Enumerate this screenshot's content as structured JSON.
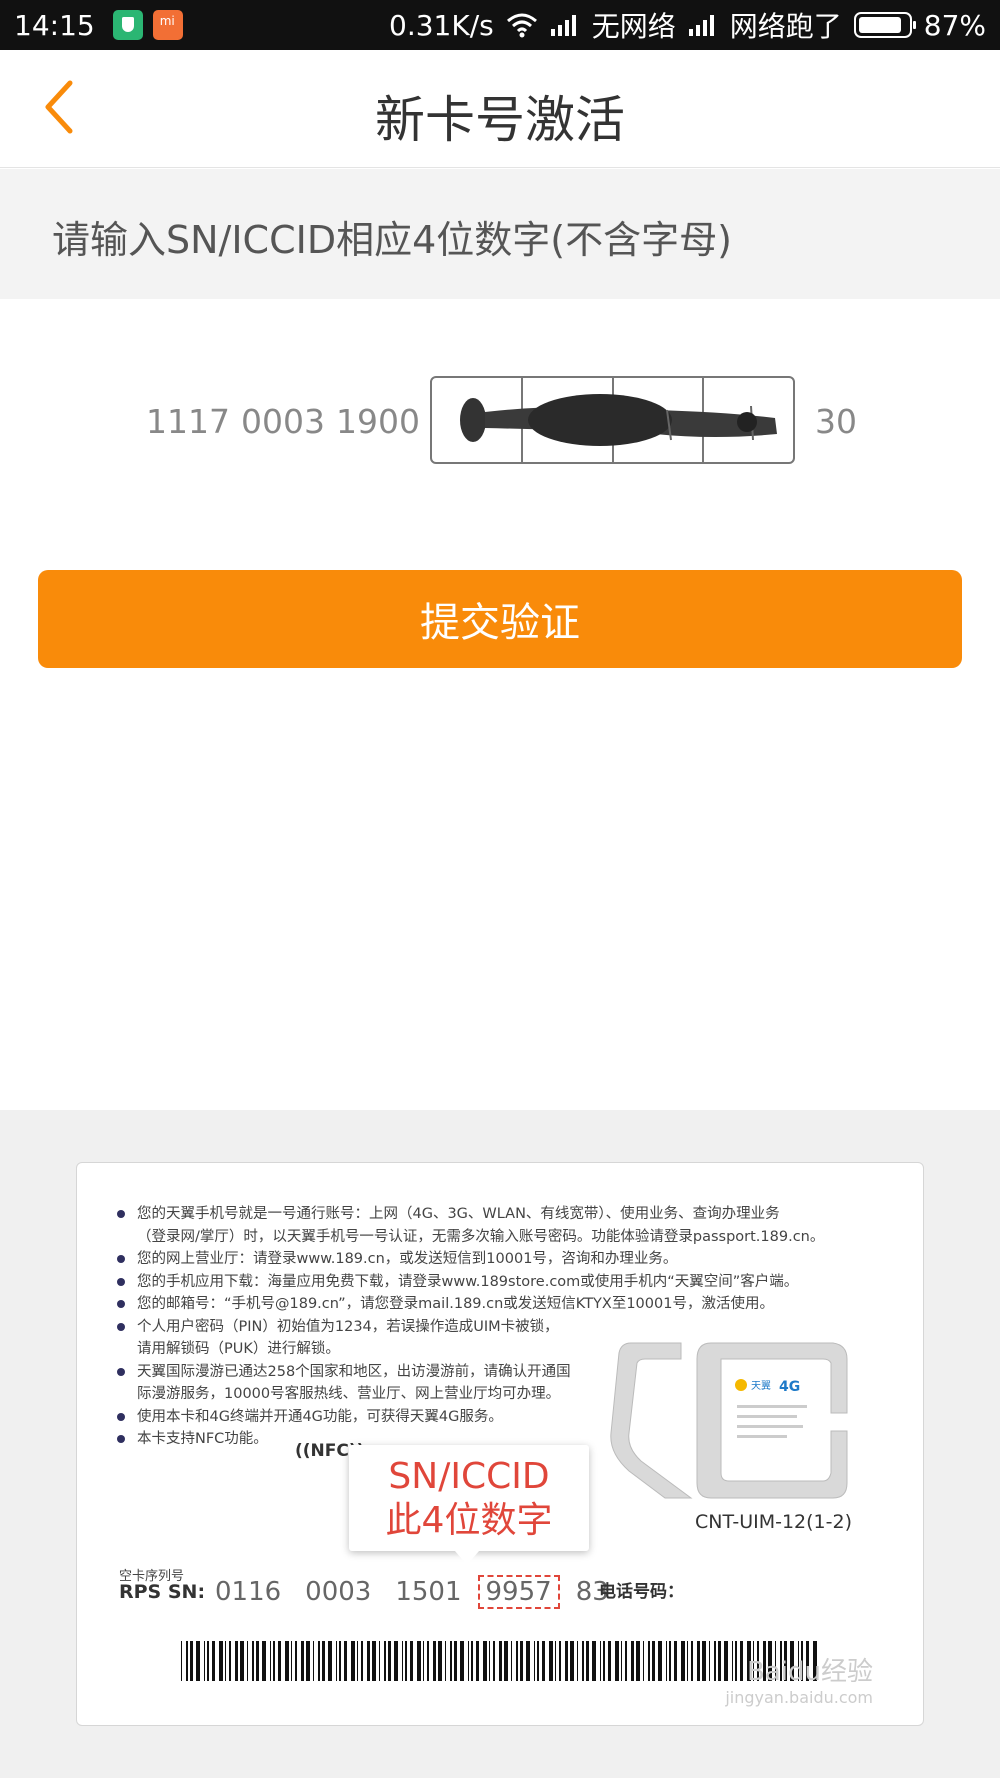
{
  "status_bar": {
    "time": "14:15",
    "speed": "0.31K/s",
    "network1": "无网络",
    "network2": "网络跑了",
    "battery": "87%"
  },
  "nav": {
    "title": "新卡号激活",
    "back_icon": "chevron-left-icon",
    "accent_color": "#f98b0a"
  },
  "instruction": "请输入SN/ICCID相应4位数字(不含字母)",
  "sn_input": {
    "prefix_groups": [
      "1117",
      "0003",
      "1900"
    ],
    "suffix": "30"
  },
  "submit_label": "提交验证",
  "hint_card": {
    "bullets": [
      "您的天翼手机号就是一号通行账号：上网（4G、3G、WLAN、有线宽带）、使用业务、查询办理业务",
      "（登录网/掌厅）时，以天翼手机号一号认证，无需多次输入账号密码。功能体验请登录passport.189.cn。",
      "您的网上营业厅：请登录www.189.cn，或发送短信到10001号，咨询和办理业务。",
      "您的手机应用下载：海量应用免费下载，请登录www.189store.com或使用手机内“天翼空间”客户端。",
      "您的邮箱号：“手机号@189.cn”，请您登录mail.189.cn或发送短信KTYX至10001号，激活使用。",
      "个人用户密码（PIN）初始值为1234，若误操作造成UIM卡被锁，",
      "请用解锁码（PUK）进行解锁。",
      "天翼国际漫游已通达258个国家和地区，出访漫游前，请确认开通国",
      "际漫游服务，10000号客服热线、营业厅、网上营业厅均可办理。",
      "使用本卡和4G终端并开通4G功能，可获得天翼4G服务。",
      "本卡支持NFC功能。"
    ],
    "nfc_mark": "((NFC))",
    "callout_line1": "SN/ICCID",
    "callout_line2": "此4位数字",
    "sim_model": "CNT-UIM-12(1-2)",
    "sn_label_cn": "空卡序列号",
    "sn_label": "RPS SN:",
    "sn_groups": [
      "0116",
      "0003",
      "1501",
      "9957",
      "83"
    ],
    "phone_label": "电话号码：",
    "watermark": "Baidu经验",
    "watermark_url": "jingyan.baidu.com"
  }
}
